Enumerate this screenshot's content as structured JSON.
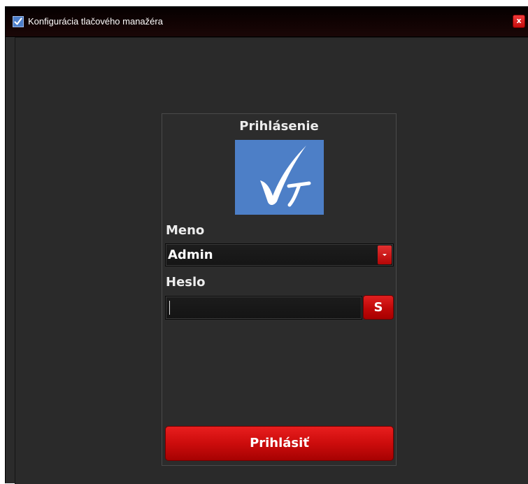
{
  "window": {
    "title": "Konfigurácia tlačového manažéra",
    "close_label": "x",
    "app_icon": "checkmark-app-icon"
  },
  "login": {
    "title": "Prihlásenie",
    "logo": "checkmark-t-logo",
    "username_label": "Meno",
    "username_value": "Admin",
    "password_label": "Heslo",
    "password_value": "",
    "show_password_label": "S",
    "submit_label": "Prihlásiť"
  },
  "colors": {
    "accent": "#cc0c0c",
    "logo_bg": "#4d7fc7",
    "window_bg": "#2a2a2a"
  }
}
